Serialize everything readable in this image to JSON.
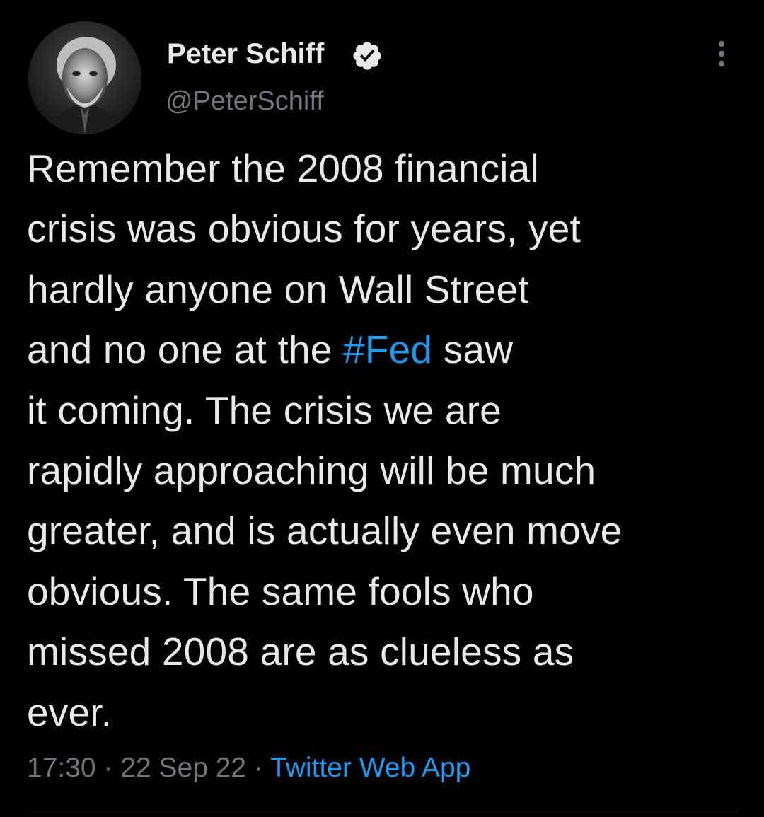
{
  "tweet": {
    "author": {
      "display_name": "Peter Schiff",
      "handle": "@PeterSchiff",
      "verified": true,
      "avatar_icon": "profile-photo"
    },
    "text_lines": [
      [
        "Remember the 2008 financial"
      ],
      [
        "crisis was obvious for years, yet"
      ],
      [
        "hardly anyone on Wall Street"
      ],
      [
        "and no one at the ",
        "#Fed",
        " saw"
      ],
      [
        "it coming. The crisis we are"
      ],
      [
        "rapidly approaching will be much"
      ],
      [
        "greater, and is actually even move"
      ],
      [
        "obvious. The same fools who"
      ],
      [
        "missed 2008 are as clueless as"
      ],
      [
        "ever."
      ]
    ],
    "time": "17:30",
    "date": "22 Sep 22",
    "separator": " · ",
    "source": "Twitter Web App"
  },
  "colors": {
    "background": "#000000",
    "text": "#e7e9ea",
    "secondary": "#71767b",
    "accent": "#1d9bf0",
    "divider": "#2f3336"
  },
  "icons": {
    "verified": "verified-badge-icon",
    "more": "more-options-icon"
  }
}
